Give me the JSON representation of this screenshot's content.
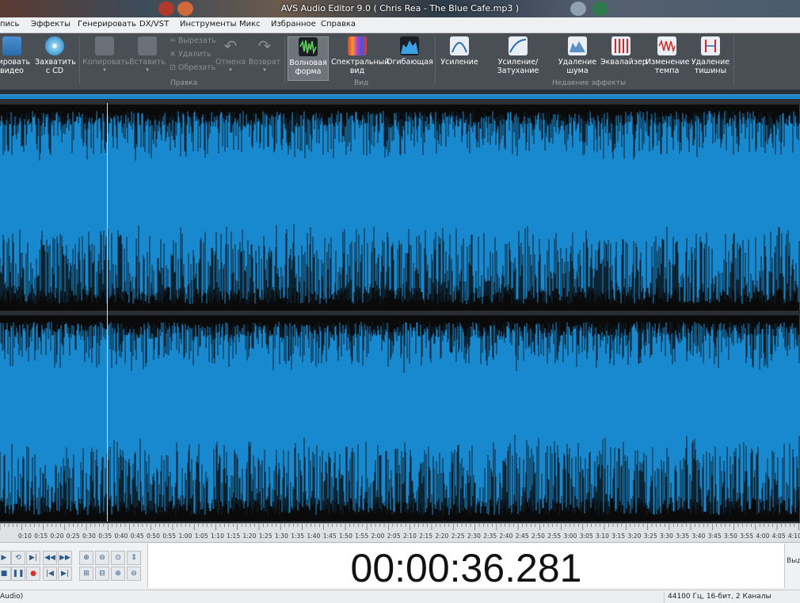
{
  "window": {
    "title": "AVS Audio Editor 9.0  ( Chris Rea - The Blue Cafe.mp3 )"
  },
  "menu": [
    "пись",
    "Эффекты",
    "Генерировать",
    "DX/VST",
    "Инструменты",
    "Микс",
    "Избранное",
    "Справка"
  ],
  "ribbon": {
    "export_video": {
      "line1": "тировать",
      "line2": "видео"
    },
    "capture_cd": {
      "line1": "Захватить",
      "line2": "с CD"
    },
    "copy": "Копировать",
    "paste": "Вставить",
    "cut": "Вырезать",
    "delete": "Удалить",
    "trim": "Обрезать",
    "undo": "Отмена",
    "redo": "Возврат",
    "edit_group": "Правка",
    "waveform": {
      "line1": "Волновая",
      "line2": "форма"
    },
    "spectral": {
      "line1": "Спектральный",
      "line2": "вид"
    },
    "envelope": "Огибающая",
    "view_group": "Вид",
    "amplify": "Усиление",
    "fade": "Усиление/Затухание",
    "noise_removal": {
      "line1": "Удаление",
      "line2": "шума"
    },
    "equalizer": "Эквалайзер",
    "tempo": {
      "line1": "Изменение",
      "line2": "темпа"
    },
    "silence_removal": {
      "line1": "Удаление",
      "line2": "тишины"
    },
    "recent_group": "Недавние эффекты"
  },
  "ruler": {
    "labels": [
      "0:10",
      "0:15",
      "0:20",
      "0:25",
      "0:30",
      "0:35",
      "0:40",
      "0:45",
      "0:50",
      "0:55",
      "1:00",
      "1:05",
      "1:10",
      "1:15",
      "1:20",
      "1:25",
      "1:30",
      "1:35",
      "1:40",
      "1:45",
      "1:50",
      "1:55",
      "2:00",
      "2:05",
      "2:10",
      "2:15",
      "2:20",
      "2:25",
      "2:30",
      "2:35",
      "2:40",
      "2:45",
      "2:50",
      "2:55",
      "3:00",
      "3:05",
      "3:10",
      "3:15",
      "3:20",
      "3:25",
      "3:30",
      "3:35",
      "3:40",
      "3:45",
      "3:50",
      "3:55",
      "4:00",
      "4:05",
      "4:10"
    ]
  },
  "transport": {
    "time": "00:00:36.281",
    "right_label": "Выд"
  },
  "status": {
    "left": "Audio)",
    "right": "44100 Гц, 16-бит, 2 Каналы"
  },
  "colors": {
    "wave_bg": "#1889cf",
    "wave_fg": "#0a0a0a",
    "accent": "#1b86c8"
  }
}
